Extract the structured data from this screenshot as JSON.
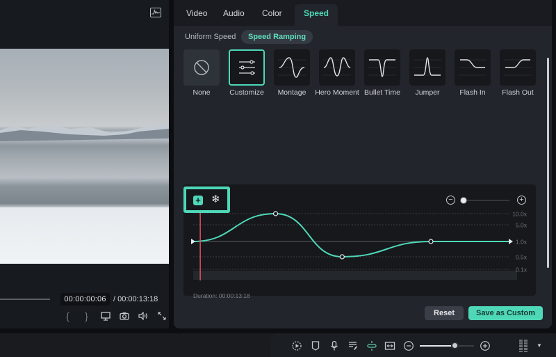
{
  "preview": {
    "current_timecode": "00:00:00:06",
    "total_timecode": "/ 00:00:13:18",
    "controls": [
      {
        "icon": "mark-in-icon",
        "glyph": "{"
      },
      {
        "icon": "mark-out-icon",
        "glyph": "}"
      },
      {
        "icon": "display-settings-icon",
        "glyph": "▭"
      },
      {
        "icon": "snapshot-icon",
        "glyph": "◉"
      },
      {
        "icon": "volume-icon",
        "glyph": "◁)"
      },
      {
        "icon": "fullscreen-icon",
        "glyph": "⤡"
      }
    ]
  },
  "tabs": [
    {
      "label": "Video",
      "active": false
    },
    {
      "label": "Audio",
      "active": false
    },
    {
      "label": "Color",
      "active": false
    },
    {
      "label": "Speed",
      "active": true
    }
  ],
  "sub_tabs": [
    {
      "label": "Uniform Speed",
      "active": false
    },
    {
      "label": "Speed Ramping",
      "active": true
    }
  ],
  "presets": [
    {
      "label": "None",
      "icon": "none-icon",
      "selected": false
    },
    {
      "label": "Customize",
      "icon": "customize-sliders-icon",
      "selected": true
    },
    {
      "label": "Montage",
      "icon": "montage-curve-icon",
      "selected": false
    },
    {
      "label": "Hero Moment",
      "icon": "hero-moment-curve-icon",
      "selected": false
    },
    {
      "label": "Bullet Time",
      "icon": "bullet-time-curve-icon",
      "selected": false
    },
    {
      "label": "Jumper",
      "icon": "jumper-curve-icon",
      "selected": false
    },
    {
      "label": "Flash In",
      "icon": "flash-in-curve-icon",
      "selected": false
    },
    {
      "label": "Flash Out",
      "icon": "flash-out-curve-icon",
      "selected": false
    }
  ],
  "editor": {
    "speed_labels": [
      "10.0x",
      "5.0x",
      "1.0x",
      "0.5x",
      "0.1x"
    ],
    "duration": "Duration: 00:00:13:18",
    "playhead_fraction": 0.02,
    "zoom_level_fraction": 0.0,
    "keyframes": [
      {
        "t": 0.0,
        "speed": 1.0
      },
      {
        "t": 0.26,
        "speed": 10.0
      },
      {
        "t": 0.47,
        "speed": 0.5
      },
      {
        "t": 0.75,
        "speed": 1.0
      },
      {
        "t": 1.0,
        "speed": 1.0
      }
    ],
    "accent_color": "#4fd8b8",
    "playhead_color": "#e0545e"
  },
  "actions": {
    "reset_label": "Reset",
    "save_label": "Save as Custom"
  },
  "toolbar": {
    "icons": [
      "render-preview-icon",
      "marker-icon",
      "voiceover-mic-icon",
      "auto-lyrics-icon",
      "snap-link-icon",
      "fit-timeline-icon"
    ],
    "zoom_fraction": 0.65
  }
}
